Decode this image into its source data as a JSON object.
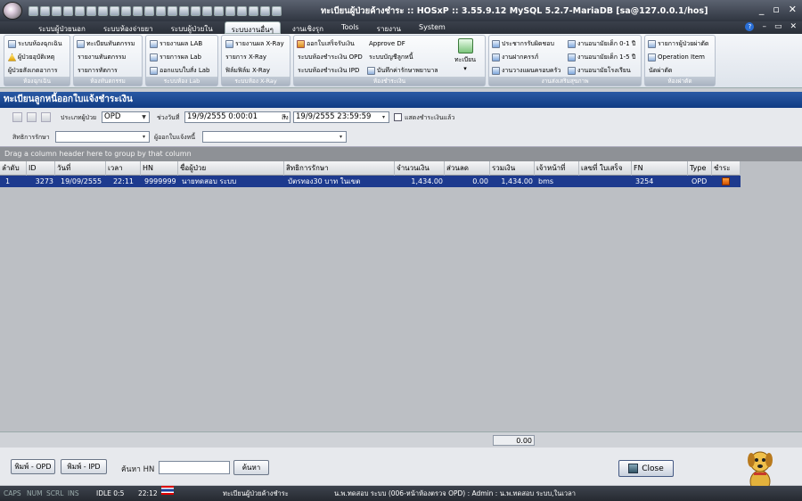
{
  "window": {
    "title": "ทะเบียนผู้ป่วยค้างชำระ :: HOSxP :: 3.55.9.12 MySQL 5.2.7-MariaDB [sa@127.0.0.1/hos]"
  },
  "tabs": [
    "ระบบผู้ป่วยนอก",
    "ระบบห้องจ่ายยา",
    "ระบบผู้ป่วยใน",
    "ระบบงานอื่นๆ",
    "งานเชิงรุก",
    "Tools",
    "รายงาน",
    "System"
  ],
  "ribbon": {
    "g1": {
      "items": [
        "ระบบห้องฉุกเฉิน",
        "ผู้ป่วยอุบัติเหตุ",
        "ผู้ป่วยสังเกตอาการ"
      ],
      "caption": "ห้องฉุกเฉิน"
    },
    "g2": {
      "items": [
        "ทะเบียนทันตกรรม",
        "รายงานทันตกรรม",
        "รายการทัตการ"
      ],
      "caption": "ห้องทันตกรรม"
    },
    "g3": {
      "items": [
        "รายงานผล LAB",
        "รายการผล Lab",
        "ออกแบบใบสั่ง Lab"
      ],
      "caption": "ระบบห้อง Lab"
    },
    "g4": {
      "items": [
        "รายงานผล X-Ray",
        "รายการ X-Ray",
        "ฟิล์มฟิล์ม X-Ray"
      ],
      "caption": "ระบบห้อง X-Ray"
    },
    "g5": {
      "items": [
        "ออกใบเสร็จรับเงิน",
        "ระบบห้องชำระเงิน OPD",
        "ระบบห้องชำระเงิน IPD",
        "Approve DF",
        "ระบบบัญชีลูกหนี้",
        "บันทึกค่ารักษาพยาบาล"
      ],
      "big": "ทะเบียน",
      "caption": "ห้องชำระเงิน"
    },
    "g6": {
      "items": [
        "ประชากรรับผิดชอบ",
        "งานฝากครรภ์",
        "งานวางแผนครอบครัว",
        "งานอนามัยเด็ก 0-1 ปี",
        "งานอนามัยเด็ก 1-5 ปี",
        "งานอนามัยโรงเรียน"
      ],
      "caption": "งานส่งเสริมสุขภาพ"
    },
    "g7": {
      "items": [
        "รายการผู้ป่วยผ่าตัด",
        "Operation Item",
        "นัดผ่าตัด"
      ],
      "caption": "ห้องผ่าตัด"
    }
  },
  "header": "ทะเบียนลูกหนี้ออกใบแจ้งชำระเงิน",
  "filters": {
    "patient_type_label": "ประเภทผู้ป่วย",
    "patient_type": "OPD",
    "date_label": "ช่วงวันที่",
    "date_from": "19/9/2555 0:00:01",
    "to_label": "ถึง",
    "date_to": "19/9/2555 23:59:59",
    "show_paid": "แสดงชำระเงินแล้ว",
    "right_label": "สิทธิการรักษา",
    "right_value": "",
    "issuer_label": "ผู้ออกใบแจ้งหนี้",
    "issuer_value": ""
  },
  "grid": {
    "group_hint": "Drag a column header here to group by that column",
    "columns": [
      "ลำดับ",
      "ID",
      "วันที่",
      "เวลา",
      "HN",
      "ชื่อผู้ป่วย",
      "สิทธิการรักษา",
      "จำนวนเงิน",
      "ส่วนลด",
      "รวมเงิน",
      "เจ้าหน้าที่",
      "เลขที่ ใบเสร็จ",
      "FN",
      "Type",
      "ชำระ"
    ],
    "rows": [
      [
        "1",
        "3273",
        "19/09/2555",
        "22:11",
        "9999999",
        "นายทดสอบ  ระบบ",
        "บัตรทอง30 บาท  ในเขต",
        "1,434.00",
        "0.00",
        "1,434.00",
        "bms",
        "",
        "3254",
        "OPD"
      ]
    ]
  },
  "footer": {
    "total": "0.00"
  },
  "bottom": {
    "print_opd": "พิมพ์ - OPD",
    "print_ipd": "พิมพ์ - IPD",
    "search_hn_label": "ค้นหา HN",
    "search_hn_value": "",
    "search_button": "ค้นหา",
    "close": "Close"
  },
  "status": {
    "caps": "CAPS",
    "num": "NUM",
    "scrl": "SCRL",
    "ins": "INS",
    "idle": "IDLE 0:5",
    "time": "22:12",
    "form": "ทะเบียนผู้ป่วยค้างชำระ",
    "user": "น.พ.ทดสอบ  ระบบ (006-หน้าห้องตรวจ OPD) : Admin : น.พ.ทดสอบ  ระบบ,ในเวลา"
  }
}
